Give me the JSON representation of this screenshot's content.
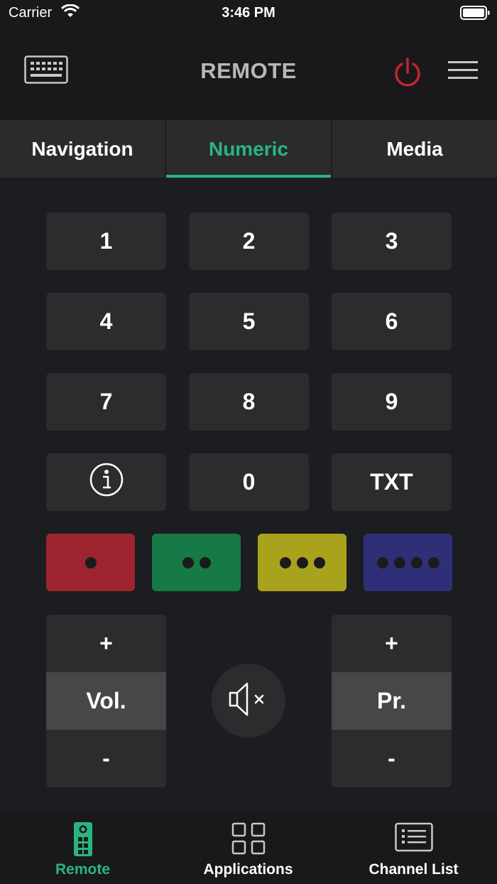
{
  "status": {
    "carrier": "Carrier",
    "time": "3:46 PM"
  },
  "header": {
    "title": "REMOTE"
  },
  "tabs": [
    {
      "label": "Navigation",
      "active": false
    },
    {
      "label": "Numeric",
      "active": true
    },
    {
      "label": "Media",
      "active": false
    }
  ],
  "keypad": {
    "k1": "1",
    "k2": "2",
    "k3": "3",
    "k4": "4",
    "k5": "5",
    "k6": "6",
    "k7": "7",
    "k8": "8",
    "k9": "9",
    "k0": "0",
    "txt": "TXT"
  },
  "color_buttons": {
    "red": "#9e2430",
    "green": "#177a46",
    "yellow": "#a9a21d",
    "blue": "#2f2f78"
  },
  "volume": {
    "plus": "+",
    "label": "Vol.",
    "minus": "-"
  },
  "program": {
    "plus": "+",
    "label": "Pr.",
    "minus": "-"
  },
  "tabbar": {
    "remote": "Remote",
    "applications": "Applications",
    "channel_list": "Channel List"
  },
  "colors": {
    "accent": "#2ab57f",
    "power": "#c0272d"
  }
}
